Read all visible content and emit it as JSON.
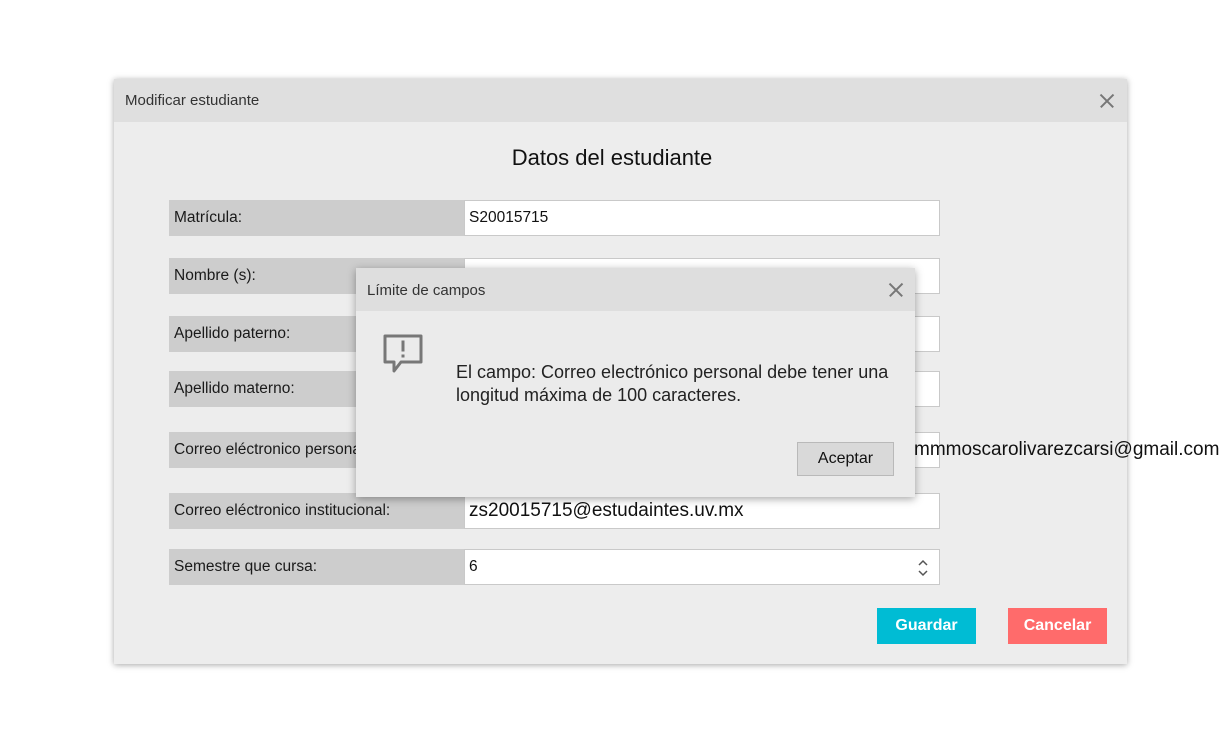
{
  "window": {
    "title": "Modificar estudiante",
    "heading": "Datos del estudiante"
  },
  "form": {
    "matricula": {
      "label": "Matrícula:",
      "value": "S20015715"
    },
    "nombre": {
      "label": "Nombre (s):",
      "value": ""
    },
    "apellido_paterno": {
      "label": "Apellido paterno:",
      "value": ""
    },
    "apellido_materno": {
      "label": "Apellido materno:",
      "value": ""
    },
    "correo_personal": {
      "label": "Correo eléctronico personal:",
      "value": "mmmoscarolivarezcarsi@gmail.com"
    },
    "correo_institucional": {
      "label": "Correo eléctronico institucional:",
      "value": "zs20015715@estudaintes.uv.mx"
    },
    "semestre": {
      "label": "Semestre que cursa:",
      "value": "6"
    }
  },
  "buttons": {
    "save": "Guardar",
    "cancel": "Cancelar"
  },
  "dialog": {
    "title": "Límite de campos",
    "message": "El campo: Correo electrónico personal debe tener una longitud máxima de 100 caracteres.",
    "accept": "Aceptar",
    "icon": "message-alert-icon"
  },
  "colors": {
    "save_button": "#00bcd4",
    "cancel_button": "#ff6b6b",
    "label_bg": "#cdcdcd",
    "window_bg": "#ededed"
  }
}
